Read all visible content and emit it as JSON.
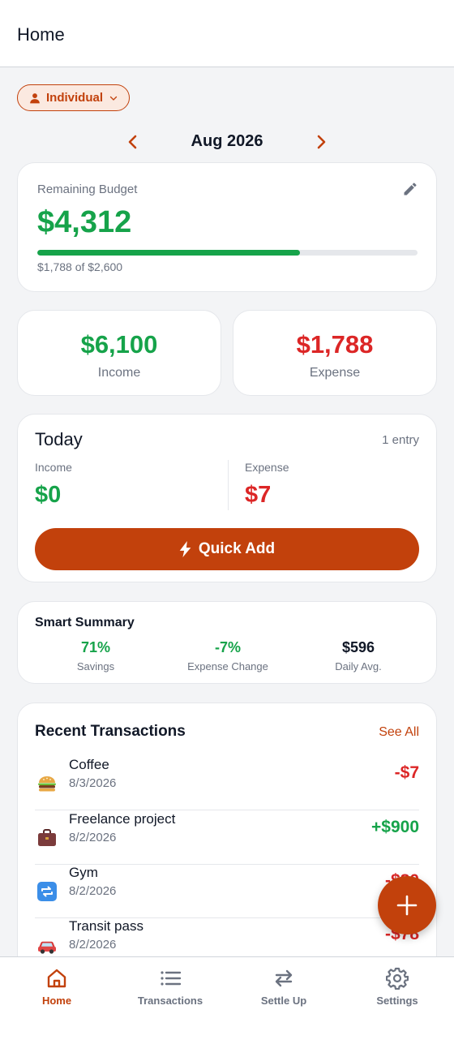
{
  "header": {
    "title": "Home"
  },
  "scope_selector": {
    "label": "Individual",
    "icon": "person-icon"
  },
  "period": {
    "label": "Aug 2026"
  },
  "budget": {
    "label": "Remaining Budget",
    "remaining": "$4,312",
    "spent_summary": "$1,788 of $2,600",
    "progress_percent": 69,
    "color": "#16a34a"
  },
  "totals": {
    "income": {
      "value": "$6,100",
      "label": "Income",
      "color": "#16a34a"
    },
    "expense": {
      "value": "$1,788",
      "label": "Expense",
      "color": "#dc2626"
    }
  },
  "today": {
    "title": "Today",
    "entries": "1 entry",
    "income_label": "Income",
    "income_value": "$0",
    "expense_label": "Expense",
    "expense_value": "$7",
    "quick_add_label": "Quick Add"
  },
  "smart_summary": {
    "title": "Smart Summary",
    "metrics": [
      {
        "value": "71%",
        "label": "Savings",
        "color": "#16a34a"
      },
      {
        "value": "-7%",
        "label": "Expense Change",
        "color": "#16a34a"
      },
      {
        "value": "$596",
        "label": "Daily Avg.",
        "color": "#111827"
      }
    ]
  },
  "recent_transactions": {
    "title": "Recent Transactions",
    "see_all_label": "See All",
    "items": [
      {
        "name": "Coffee",
        "date": "8/3/2026",
        "amount": "-$7",
        "icon": "burger-icon",
        "color": "#dc2626"
      },
      {
        "name": "Freelance project",
        "date": "8/2/2026",
        "amount": "+$900",
        "icon": "briefcase-icon",
        "color": "#16a34a"
      },
      {
        "name": "Gym",
        "date": "8/2/2026",
        "amount": "-$80",
        "icon": "repeat-icon",
        "color": "#dc2626"
      },
      {
        "name": "Transit pass",
        "date": "8/2/2026",
        "amount": "-$78",
        "icon": "car-icon",
        "color": "#dc2626"
      }
    ]
  },
  "nav": {
    "items": [
      {
        "label": "Home",
        "icon": "home-icon",
        "active": true
      },
      {
        "label": "Transactions",
        "icon": "list-icon",
        "active": false
      },
      {
        "label": "Settle Up",
        "icon": "swap-arrows-icon",
        "active": false
      },
      {
        "label": "Settings",
        "icon": "gear-icon",
        "active": false
      }
    ]
  },
  "colors": {
    "accent": "#c2410c",
    "positive": "#16a34a",
    "negative": "#dc2626"
  }
}
